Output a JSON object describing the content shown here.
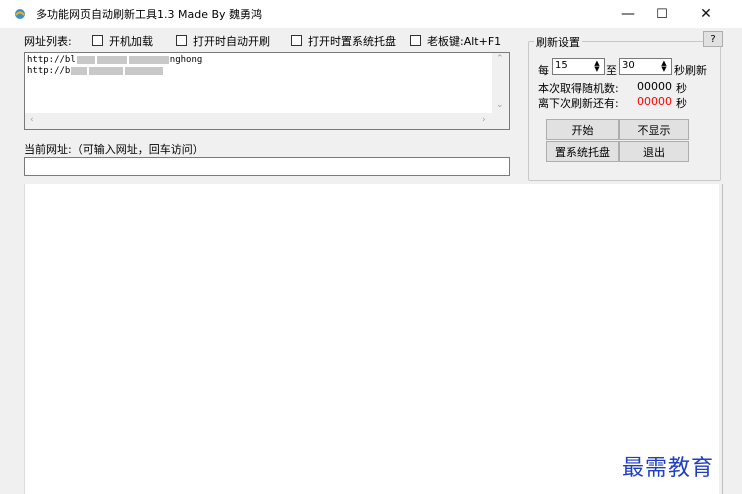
{
  "window": {
    "title": "多功能网页自动刷新工具1.3 Made By 魏勇鸿",
    "minimize": "—",
    "maximize": "☐",
    "close": "✕"
  },
  "options": {
    "url_list_label": "网址列表:",
    "boot_load": "开机加载",
    "auto_refresh_on_open": "打开时自动开刷",
    "tray_on_open": "打开时置系统托盘",
    "boss_key": "老板键:Alt+F1"
  },
  "url_list": {
    "line1_prefix": "http://bl",
    "line1_suffix": "nghong",
    "line2_prefix": "http://b"
  },
  "current_url": {
    "label": "当前网址:（可输入网址，回车访问）",
    "value": ""
  },
  "refresh_settings": {
    "title": "刷新设置",
    "help": "?",
    "every": "每",
    "from_value": "15",
    "to": "至",
    "to_value": "30",
    "unit": "秒刷新",
    "random_label": "本次取得随机数:",
    "random_value": "00000",
    "random_unit": "秒",
    "remaining_label": "离下次刷新还有:",
    "remaining_value": "00000",
    "remaining_unit": "秒",
    "start_button": "开始",
    "hide_button": "不显示",
    "tray_button": "置系统托盘",
    "exit_button": "退出"
  },
  "colors": {
    "remaining_value": "#ff0000",
    "watermark": "#1f3fbf"
  },
  "watermark": "最需教育"
}
